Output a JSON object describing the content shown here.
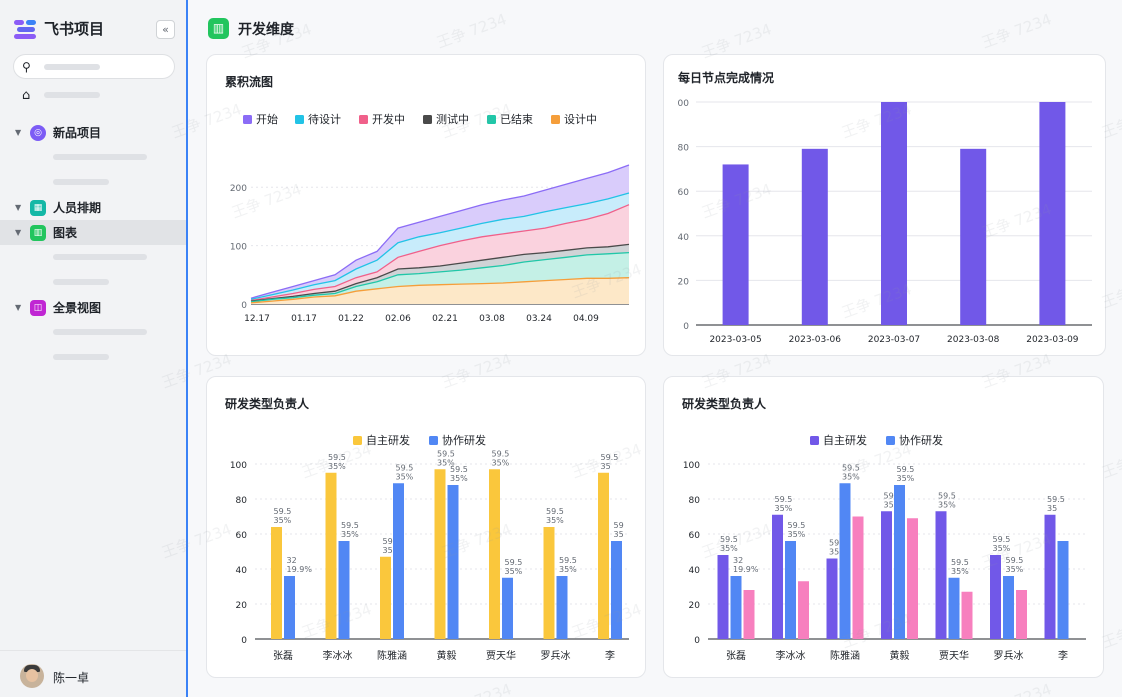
{
  "app": {
    "title": "飞书项目",
    "collapse_glyph": "«"
  },
  "sidebar": {
    "items": [
      {
        "label": "新品项目",
        "icon": "target-icon",
        "color": "#7c5cf5",
        "glyph": "◎",
        "active": false
      },
      {
        "label": "人员排期",
        "icon": "table-icon",
        "color": "#14b8a6",
        "glyph": "▦",
        "active": false
      },
      {
        "label": "图表",
        "icon": "chart-icon",
        "color": "#22c55e",
        "glyph": "▥",
        "active": true
      },
      {
        "label": "全景视图",
        "icon": "panorama-icon",
        "color": "#c026d3",
        "glyph": "◫",
        "active": false
      }
    ],
    "user": {
      "name": "陈一卓"
    }
  },
  "page": {
    "title": "开发维度",
    "icon": "chart-icon"
  },
  "watermark": "王争 7234",
  "chart_data": [
    {
      "type": "area",
      "title": "累积流图",
      "x_ticks": [
        "12.17",
        "01.17",
        "01.22",
        "02.06",
        "02.21",
        "03.08",
        "03.24",
        "04.09"
      ],
      "y_ticks": [
        0,
        100,
        200
      ],
      "ylim": [
        0,
        250
      ],
      "legend_position": "top",
      "series": [
        {
          "name": "开始",
          "color": "#8b6cf6",
          "fill": "#d9ccfb",
          "values": [
            10,
            20,
            30,
            40,
            50,
            75,
            90,
            130,
            140,
            150,
            160,
            170,
            178,
            185,
            195,
            205,
            215,
            225,
            238
          ]
        },
        {
          "name": "待设计",
          "color": "#22c3e6",
          "fill": "#c8ecfb",
          "values": [
            8,
            16,
            24,
            33,
            40,
            60,
            75,
            105,
            115,
            122,
            130,
            138,
            145,
            150,
            158,
            165,
            172,
            180,
            190
          ]
        },
        {
          "name": "开发中",
          "color": "#f0608a",
          "fill": "#fad2de",
          "values": [
            6,
            12,
            18,
            25,
            30,
            45,
            55,
            80,
            90,
            100,
            108,
            115,
            120,
            125,
            130,
            138,
            145,
            155,
            170
          ]
        },
        {
          "name": "测试中",
          "color": "#4a4a4a",
          "fill": "#d0d3d6",
          "values": [
            5,
            9,
            13,
            18,
            22,
            35,
            45,
            60,
            62,
            65,
            70,
            75,
            80,
            85,
            88,
            92,
            96,
            98,
            102
          ]
        },
        {
          "name": "已结束",
          "color": "#20c7a8",
          "fill": "#c4f0e6",
          "values": [
            4,
            8,
            11,
            15,
            18,
            30,
            38,
            50,
            52,
            55,
            58,
            62,
            66,
            72,
            76,
            80,
            84,
            86,
            88
          ]
        },
        {
          "name": "设计中",
          "color": "#f59e3a",
          "fill": "#fde8c8",
          "values": [
            2,
            5,
            8,
            12,
            14,
            22,
            26,
            30,
            32,
            33,
            34,
            35,
            36,
            38,
            40,
            42,
            44,
            44,
            45
          ]
        }
      ]
    },
    {
      "type": "bar",
      "title": "每日节点完成情况",
      "categories": [
        "2023-03-05",
        "2023-03-06",
        "2023-03-07",
        "2023-03-08",
        "2023-03-09"
      ],
      "values": [
        72,
        79,
        100,
        79,
        100
      ],
      "y_ticks": [
        "0",
        "20",
        "40",
        "60",
        "80",
        "00"
      ],
      "ylim": [
        0,
        100
      ],
      "color": "#7158e8"
    },
    {
      "type": "bar",
      "title": "研发类型负责人",
      "categories": [
        "张磊",
        "李冰冰",
        "陈雅涵",
        "黄毅",
        "贾天华",
        "罗兵冰",
        "李"
      ],
      "y_ticks": [
        0,
        20,
        40,
        60,
        80,
        100
      ],
      "ylim": [
        0,
        100
      ],
      "legend_position": "top",
      "series": [
        {
          "name": "自主研发",
          "color": "#fac73c",
          "values": [
            64,
            95,
            47,
            97,
            97,
            64,
            95
          ],
          "labels": [
            [
              "59.5",
              "35%"
            ],
            [
              "59.5",
              "35%"
            ],
            [
              "59.5",
              "35%"
            ],
            [
              "59.5",
              "35%"
            ],
            [
              "59.5",
              "35%"
            ],
            [
              "59.5",
              "35%"
            ],
            [
              "59.5",
              "35"
            ]
          ]
        },
        {
          "name": "协作研发",
          "color": "#5187f4",
          "values": [
            36,
            56,
            89,
            88,
            35,
            36,
            56
          ],
          "labels": [
            [
              "32",
              "19.9%"
            ],
            [
              "59.5",
              "35%"
            ],
            [
              "59.5",
              "35%"
            ],
            [
              "59.5",
              "35%"
            ],
            [
              "59.5",
              "35%"
            ],
            [
              "59.5",
              "35%"
            ],
            [
              "59",
              "35"
            ]
          ]
        }
      ]
    },
    {
      "type": "bar",
      "title": "研发类型负责人",
      "categories": [
        "张磊",
        "李冰冰",
        "陈雅涵",
        "黄毅",
        "贾天华",
        "罗兵冰",
        "李"
      ],
      "y_ticks": [
        0,
        20,
        40,
        60,
        80,
        100
      ],
      "ylim": [
        0,
        100
      ],
      "legend_position": "top",
      "series": [
        {
          "name": "自主研发",
          "color": "#7158e8",
          "values": [
            48,
            71,
            46,
            73,
            73,
            48,
            71
          ],
          "labels": [
            [
              "59.5",
              "35%"
            ],
            [
              "59.5",
              "35%"
            ],
            [
              "59.5",
              "35%"
            ],
            [
              "59.5",
              "35%"
            ],
            [
              "59.5",
              "35%"
            ],
            [
              "59.5",
              "35%"
            ],
            [
              "59.5",
              "35"
            ]
          ]
        },
        {
          "name": "协作研发",
          "color": "#5187f4",
          "values": [
            36,
            56,
            89,
            88,
            35,
            36,
            56
          ],
          "labels": [
            [
              "32",
              "19.9%"
            ],
            [
              "59.5",
              "35%"
            ],
            [
              "59.5",
              "35%"
            ],
            [
              "59.5",
              "35%"
            ],
            [
              "59.5",
              "35%"
            ],
            [
              "59.5",
              "35%"
            ],
            [
              "",
              ""
            ]
          ]
        },
        {
          "name": "",
          "color": "#f77fbe",
          "values": [
            28,
            33,
            70,
            69,
            27,
            28,
            0
          ]
        }
      ]
    }
  ]
}
